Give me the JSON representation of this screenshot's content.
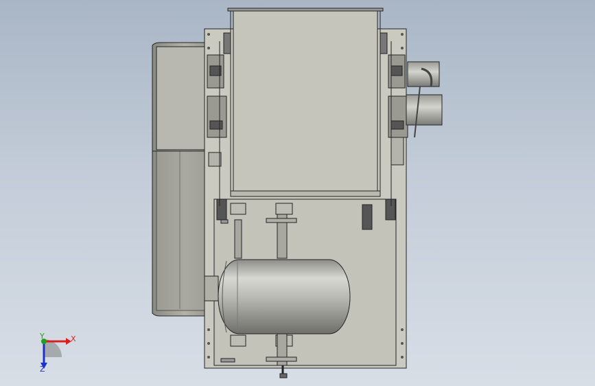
{
  "viewport": {
    "background_top": "#a9b6c6",
    "background_bottom": "#d8dee6"
  },
  "model": {
    "body_color": "#c9c8bd",
    "edge_color": "#2a2a2a",
    "motor_color": "#b8b8b2",
    "fan_color": "#a8a8a0"
  },
  "triad": {
    "x_label": "X",
    "y_label": "Y",
    "z_label": "Z",
    "x_color": "#d82020",
    "y_color": "#1fa01f",
    "z_color": "#2030c8"
  }
}
